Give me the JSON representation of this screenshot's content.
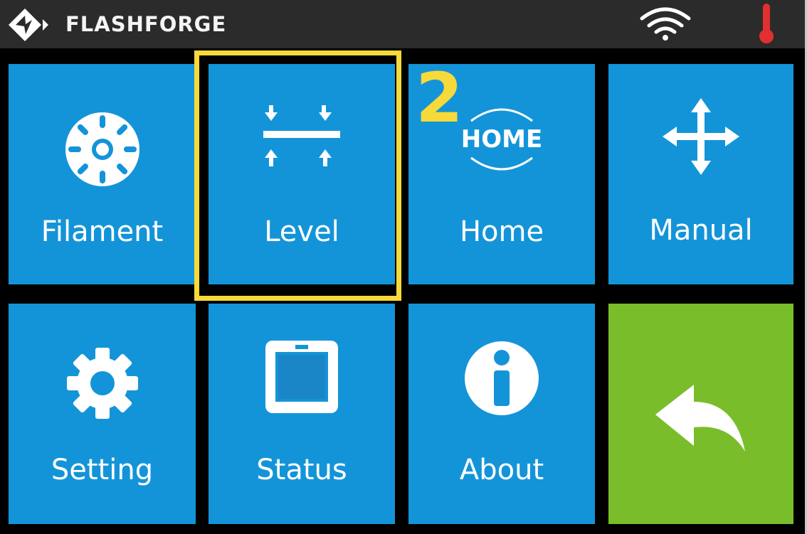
{
  "status_bar": {
    "brand": "FLASHFORGE",
    "logo_icon": "flashforge-logo-icon",
    "wifi_icon": "wifi-icon",
    "temperature_icon": "thermometer-icon",
    "temperature_color": "#e03030"
  },
  "menu": {
    "tiles": [
      {
        "label": "Filament",
        "icon": "filament-spool-icon"
      },
      {
        "label": "Level",
        "icon": "level-arrows-icon"
      },
      {
        "label": "Home",
        "icon": "home-icon",
        "icon_text": "HOME"
      },
      {
        "label": "Manual",
        "icon": "move-arrows-icon"
      },
      {
        "label": "Setting",
        "icon": "gear-icon"
      },
      {
        "label": "Status",
        "icon": "printer-status-icon"
      },
      {
        "label": "About",
        "icon": "info-icon"
      },
      {
        "label": "",
        "icon": "back-arrow-icon"
      }
    ]
  },
  "annotation": {
    "step_number": "2",
    "highlighted_tile": "Level",
    "color": "#f7d93a"
  },
  "colors": {
    "tile_blue": "#1494d8",
    "back_green": "#7abd2a",
    "status_bar": "#2b2b2b",
    "background": "#000000"
  }
}
